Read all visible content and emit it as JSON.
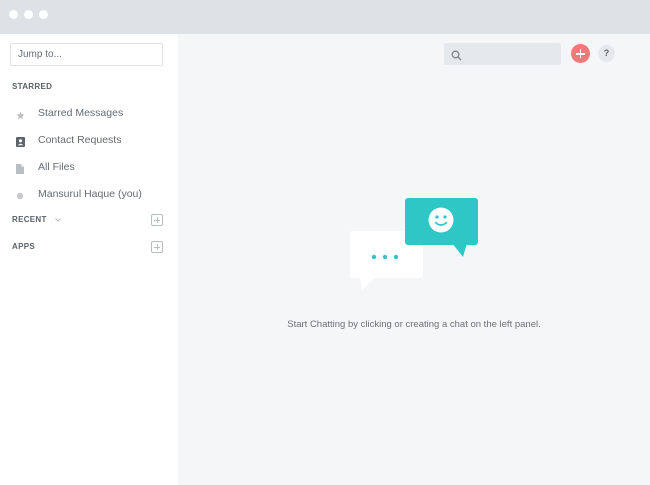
{
  "window": {
    "controls": [
      "close",
      "minimize",
      "maximize"
    ]
  },
  "sidebar": {
    "jump_placeholder": "Jump to...",
    "starred_label": "STARRED",
    "items": [
      {
        "label": "Starred Messages",
        "icon": "star-icon"
      },
      {
        "label": "Contact Requests",
        "icon": "contact-card-icon"
      },
      {
        "label": "All Files",
        "icon": "file-icon"
      },
      {
        "label": "Mansurul Haque (you)",
        "icon": "status-dot-icon"
      }
    ],
    "recent_label": "RECENT",
    "apps_label": "APPS"
  },
  "toolbar": {
    "help_label": "?"
  },
  "main": {
    "empty_message": "Start Chatting by clicking or creating a  chat on the left panel."
  },
  "colors": {
    "accent": "#2fc6c6",
    "add_button": "#f07a7a",
    "titlebar": "#dde2e6",
    "main_bg": "#f5f6f8"
  }
}
